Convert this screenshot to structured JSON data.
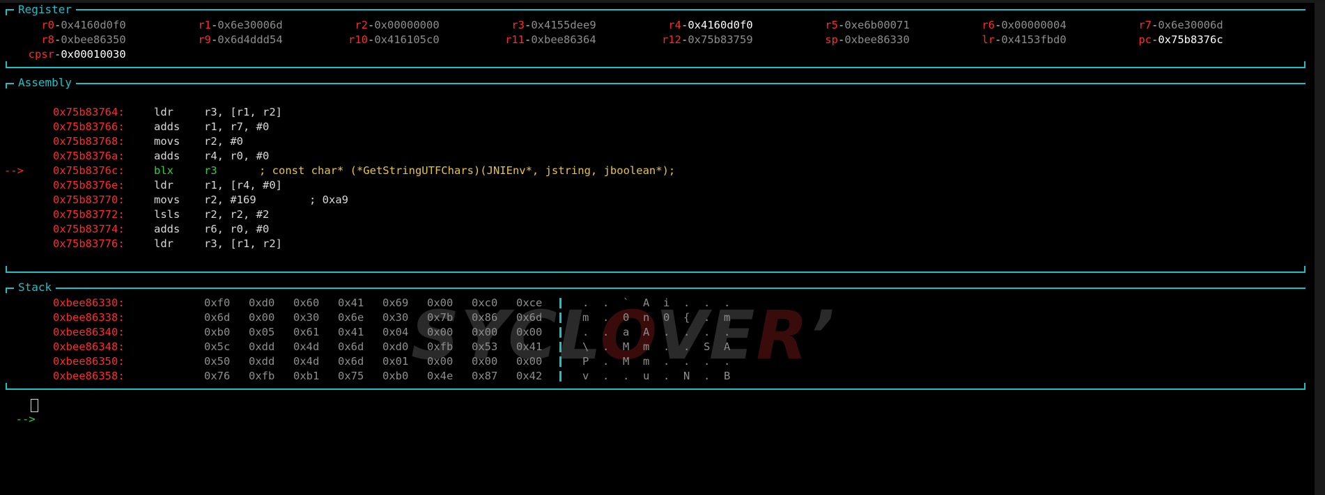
{
  "colors": {
    "accent": "#19c2c8",
    "register_name": "#ff2b2b",
    "address": "#ff2b2b",
    "current_instruction": "#2fd23a",
    "comment": "#e8c53a",
    "watermark_o": "#7a1010"
  },
  "register": {
    "title": "Register",
    "regs": [
      {
        "name": "r0",
        "value": "0x4160d0f0",
        "changed": false
      },
      {
        "name": "r1",
        "value": "0x6e30006d",
        "changed": false
      },
      {
        "name": "r2",
        "value": "0x00000000",
        "changed": false
      },
      {
        "name": "r3",
        "value": "0x4155dee9",
        "changed": false
      },
      {
        "name": "r4",
        "value": "0x4160d0f0",
        "changed": true
      },
      {
        "name": "r5",
        "value": "0xe6b00071",
        "changed": false
      },
      {
        "name": "r6",
        "value": "0x00000004",
        "changed": false
      },
      {
        "name": "r7",
        "value": "0x6e30006d",
        "changed": false
      },
      {
        "name": "r8",
        "value": "0xbee86350",
        "changed": false
      },
      {
        "name": "r9",
        "value": "0x6d4ddd54",
        "changed": false
      },
      {
        "name": "r10",
        "value": "0x416105c0",
        "changed": false
      },
      {
        "name": "r11",
        "value": "0xbee86364",
        "changed": false
      },
      {
        "name": "r12",
        "value": "0x75b83759",
        "changed": false
      },
      {
        "name": "sp",
        "value": "0xbee86330",
        "changed": false
      },
      {
        "name": "lr",
        "value": "0x4153fbd0",
        "changed": false
      },
      {
        "name": "pc",
        "value": "0x75b8376c",
        "changed": true
      },
      {
        "name": "cpsr",
        "value": "0x00010030",
        "changed": true
      }
    ]
  },
  "assembly": {
    "title": "Assembly",
    "current_marker": "-->",
    "lines": [
      {
        "addr": "0x75b83764:",
        "mnemonic": "ldr",
        "operands": "r3, [r1, r2]",
        "comment": "",
        "current": false
      },
      {
        "addr": "0x75b83766:",
        "mnemonic": "adds",
        "operands": "r1, r7, #0",
        "comment": "",
        "current": false
      },
      {
        "addr": "0x75b83768:",
        "mnemonic": "movs",
        "operands": "r2, #0",
        "comment": "",
        "current": false
      },
      {
        "addr": "0x75b8376a:",
        "mnemonic": "adds",
        "operands": "r4, r0, #0",
        "comment": "",
        "current": false
      },
      {
        "addr": "0x75b8376c:",
        "mnemonic": "blx",
        "operands": "r3",
        "comment": "; const char* (*GetStringUTFChars)(JNIEnv*, jstring, jboolean*);",
        "current": true
      },
      {
        "addr": "0x75b8376e:",
        "mnemonic": "ldr",
        "operands": "r1, [r4, #0]",
        "comment": "",
        "current": false
      },
      {
        "addr": "0x75b83770:",
        "mnemonic": "movs",
        "operands": "r2, #169",
        "comment2": "; 0xa9",
        "current": false
      },
      {
        "addr": "0x75b83772:",
        "mnemonic": "lsls",
        "operands": "r2, r2, #2",
        "comment": "",
        "current": false
      },
      {
        "addr": "0x75b83774:",
        "mnemonic": "adds",
        "operands": "r6, r0, #0",
        "comment": "",
        "current": false
      },
      {
        "addr": "0x75b83776:",
        "mnemonic": "ldr",
        "operands": "r3, [r1, r2]",
        "comment": "",
        "current": false
      }
    ]
  },
  "stack": {
    "title": "Stack",
    "rows": [
      {
        "addr": "0xbee86330:",
        "bytes": [
          "0xf0",
          "0xd0",
          "0x60",
          "0x41",
          "0x69",
          "0x00",
          "0xc0",
          "0xce"
        ],
        "ascii": [
          ".",
          ".",
          "`",
          "A",
          "i",
          ".",
          ".",
          "."
        ]
      },
      {
        "addr": "0xbee86338:",
        "bytes": [
          "0x6d",
          "0x00",
          "0x30",
          "0x6e",
          "0x30",
          "0x7b",
          "0x86",
          "0x6d"
        ],
        "ascii": [
          "m",
          ".",
          "0",
          "n",
          "0",
          "{",
          ".",
          "m"
        ]
      },
      {
        "addr": "0xbee86340:",
        "bytes": [
          "0xb0",
          "0x05",
          "0x61",
          "0x41",
          "0x04",
          "0x00",
          "0x00",
          "0x00"
        ],
        "ascii": [
          ".",
          ".",
          "a",
          "A",
          ".",
          ".",
          ".",
          "."
        ]
      },
      {
        "addr": "0xbee86348:",
        "bytes": [
          "0x5c",
          "0xdd",
          "0x4d",
          "0x6d",
          "0xd0",
          "0xfb",
          "0x53",
          "0x41"
        ],
        "ascii": [
          "\\",
          ".",
          "M",
          "m",
          ".",
          ".",
          "S",
          "A"
        ]
      },
      {
        "addr": "0xbee86350:",
        "bytes": [
          "0x50",
          "0xdd",
          "0x4d",
          "0x6d",
          "0x01",
          "0x00",
          "0x00",
          "0x00"
        ],
        "ascii": [
          "P",
          ".",
          "M",
          "m",
          ".",
          ".",
          ".",
          "."
        ]
      },
      {
        "addr": "0xbee86358:",
        "bytes": [
          "0x76",
          "0xfb",
          "0xb1",
          "0x75",
          "0xb0",
          "0x4e",
          "0x87",
          "0x42"
        ],
        "ascii": [
          "v",
          ".",
          ".",
          "u",
          ".",
          "N",
          ".",
          "B"
        ]
      }
    ]
  },
  "watermark": {
    "pre": "SYCL",
    "o": "O",
    "mid": "VE",
    "r": "R",
    "post": "’"
  },
  "prompt": {
    "arrow": "-->",
    "input": ""
  }
}
